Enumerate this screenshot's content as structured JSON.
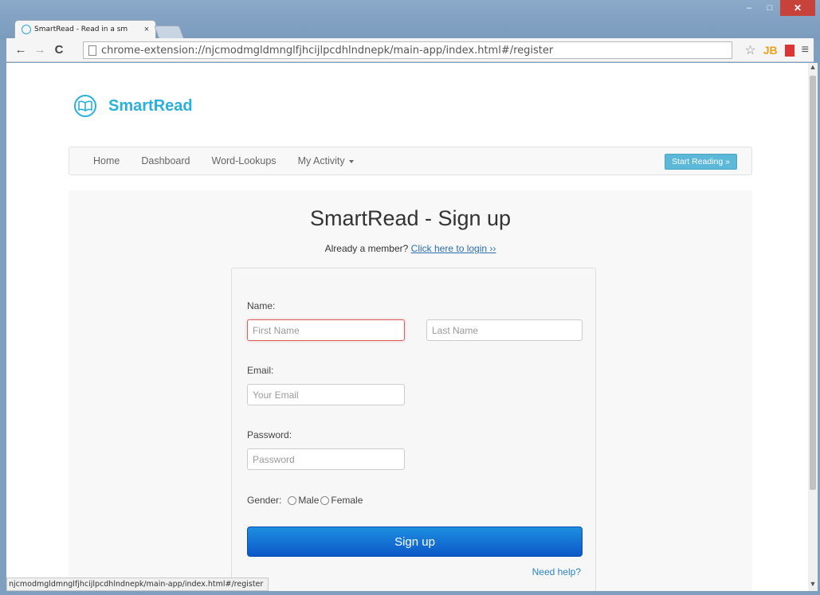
{
  "browser": {
    "tab_title": "SmartRead - Read in a sm",
    "tab_close": "×",
    "url": "chrome-extension://njcmodmgldmnglfjhcijlpcdhlndnepk/main-app/index.html#/register",
    "status_url": "njcmodmgldmnglfjhcijlpcdhlndnepk/main-app/index.html#/register",
    "back": "←",
    "forward": "→",
    "reload": "C",
    "star": "☆",
    "jb": "JB",
    "menu": "≡",
    "minimize": "‒",
    "maximize": "□",
    "close": "✕"
  },
  "brand": {
    "name": "SmartRead",
    "icon": "open-book-icon",
    "color": "#2ab0dc"
  },
  "nav": {
    "items": [
      "Home",
      "Dashboard",
      "Word-Lookups",
      "My Activity"
    ],
    "start_button": "Start Reading »"
  },
  "page": {
    "title": "SmartRead - Sign up",
    "login_prompt": "Already a member?",
    "login_link": "Click here to login ››"
  },
  "form": {
    "name_label": "Name:",
    "first_name_placeholder": "First Name",
    "last_name_placeholder": "Last Name",
    "email_label": "Email:",
    "email_placeholder": "Your Email",
    "password_label": "Password:",
    "password_placeholder": "Password",
    "gender_label": "Gender:",
    "gender_options": [
      "Male",
      "Female"
    ],
    "submit": "Sign up",
    "help_link": "Need help?",
    "submit_color": "#1473d8"
  }
}
